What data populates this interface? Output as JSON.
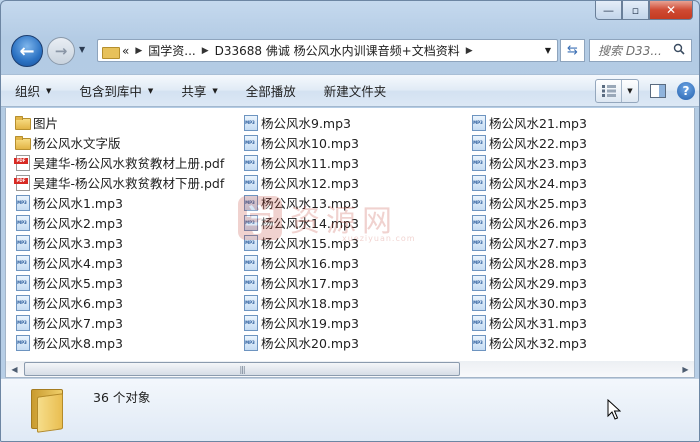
{
  "window": {
    "minimize_glyph": "—",
    "maximize_glyph": "▫",
    "close_glyph": "✕"
  },
  "address": {
    "history_glyph": "«",
    "crumbs": [
      "国学资...",
      "D33688 佛诚 杨公风水内训课音频+文档资料"
    ],
    "search_placeholder": "搜索 D33..."
  },
  "toolbar": {
    "organize": "组织",
    "include_in_library": "包含到库中",
    "share": "共享",
    "play_all": "全部播放",
    "new_folder": "新建文件夹"
  },
  "files": {
    "column1": [
      {
        "name": "图片",
        "type": "folder"
      },
      {
        "name": "杨公风水文字版",
        "type": "folder"
      },
      {
        "name": "吴建华-杨公风水救贫教材上册.pdf",
        "type": "pdf"
      },
      {
        "name": "吴建华-杨公风水救贫教材下册.pdf",
        "type": "pdf"
      },
      {
        "name": "杨公风水1.mp3",
        "type": "mp3"
      },
      {
        "name": "杨公风水2.mp3",
        "type": "mp3"
      },
      {
        "name": "杨公风水3.mp3",
        "type": "mp3"
      },
      {
        "name": "杨公风水4.mp3",
        "type": "mp3"
      },
      {
        "name": "杨公风水5.mp3",
        "type": "mp3"
      },
      {
        "name": "杨公风水6.mp3",
        "type": "mp3"
      },
      {
        "name": "杨公风水7.mp3",
        "type": "mp3"
      },
      {
        "name": "杨公风水8.mp3",
        "type": "mp3"
      }
    ],
    "column2": [
      {
        "name": "杨公风水9.mp3",
        "type": "mp3"
      },
      {
        "name": "杨公风水10.mp3",
        "type": "mp3"
      },
      {
        "name": "杨公风水11.mp3",
        "type": "mp3"
      },
      {
        "name": "杨公风水12.mp3",
        "type": "mp3"
      },
      {
        "name": "杨公风水13.mp3",
        "type": "mp3"
      },
      {
        "name": "杨公风水14.mp3",
        "type": "mp3"
      },
      {
        "name": "杨公风水15.mp3",
        "type": "mp3"
      },
      {
        "name": "杨公风水16.mp3",
        "type": "mp3"
      },
      {
        "name": "杨公风水17.mp3",
        "type": "mp3"
      },
      {
        "name": "杨公风水18.mp3",
        "type": "mp3"
      },
      {
        "name": "杨公风水19.mp3",
        "type": "mp3"
      },
      {
        "name": "杨公风水20.mp3",
        "type": "mp3"
      }
    ],
    "column3": [
      {
        "name": "杨公风水21.mp3",
        "type": "mp3"
      },
      {
        "name": "杨公风水22.mp3",
        "type": "mp3"
      },
      {
        "name": "杨公风水23.mp3",
        "type": "mp3"
      },
      {
        "name": "杨公风水24.mp3",
        "type": "mp3"
      },
      {
        "name": "杨公风水25.mp3",
        "type": "mp3"
      },
      {
        "name": "杨公风水26.mp3",
        "type": "mp3"
      },
      {
        "name": "杨公风水27.mp3",
        "type": "mp3"
      },
      {
        "name": "杨公风水28.mp3",
        "type": "mp3"
      },
      {
        "name": "杨公风水29.mp3",
        "type": "mp3"
      },
      {
        "name": "杨公风水30.mp3",
        "type": "mp3"
      },
      {
        "name": "杨公风水31.mp3",
        "type": "mp3"
      },
      {
        "name": "杨公风水32.mp3",
        "type": "mp3"
      }
    ]
  },
  "watermark": {
    "logo_glyph": "学",
    "text": "资源网",
    "sub": "xueziyuan.com"
  },
  "details": {
    "count": "36 个对象"
  },
  "icons": {
    "back": "back-arrow-icon",
    "forward": "forward-arrow-icon",
    "refresh": "refresh-icon",
    "search": "search-icon",
    "views": "view-grid-icon",
    "preview_pane": "preview-pane-icon",
    "help": "help-icon"
  }
}
